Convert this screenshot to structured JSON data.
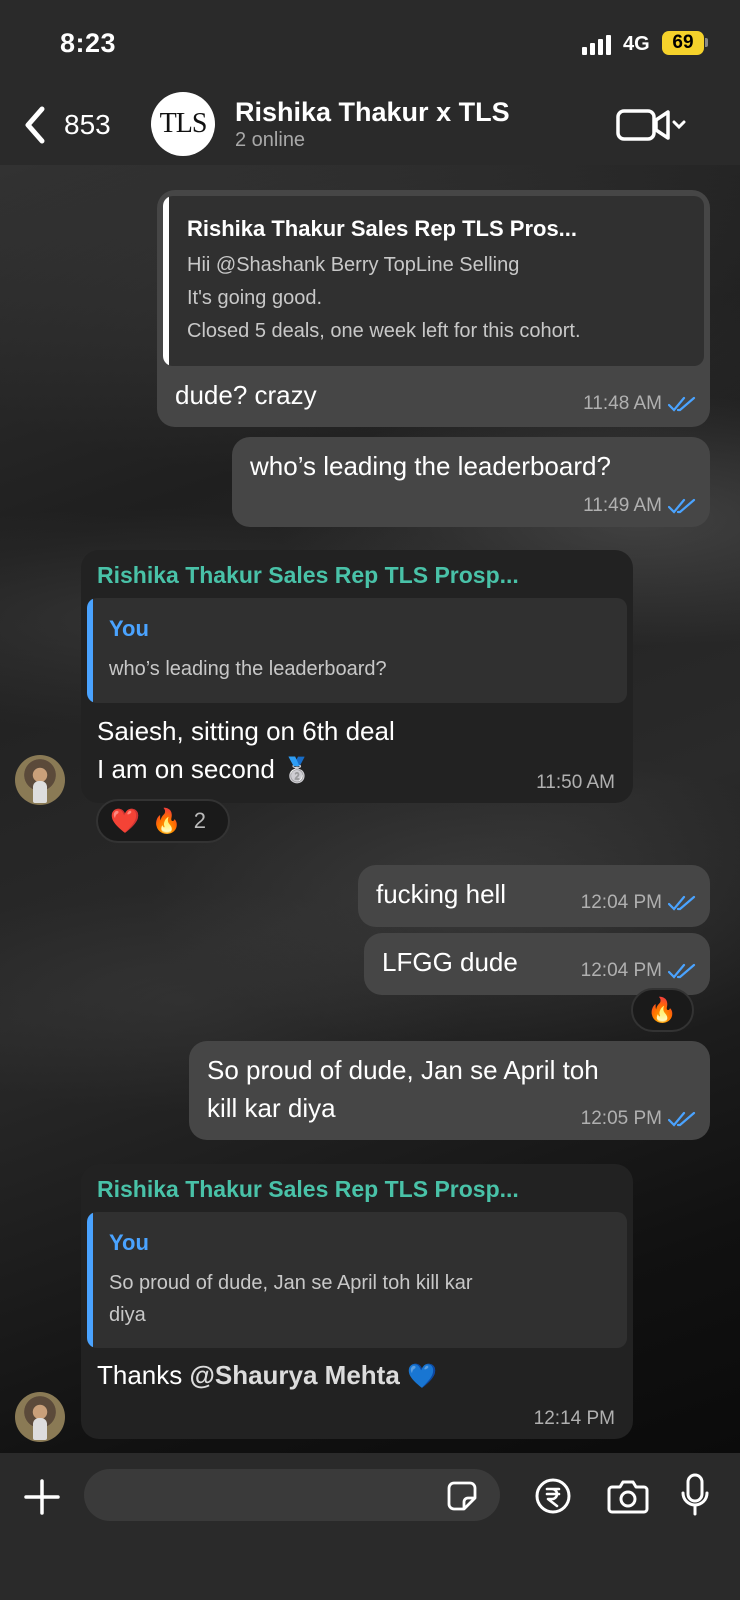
{
  "status_bar": {
    "time": "8:23",
    "network": "4G",
    "battery": "69"
  },
  "header": {
    "back_count": "853",
    "logo_text": "TLS",
    "title": "Rishika Thakur x TLS",
    "subtitle": "2 online"
  },
  "messages": [
    {
      "quote_title": "Rishika Thakur Sales Rep TLS Pros...",
      "quote_lines": [
        "Hii @Shashank Berry TopLine Selling",
        "It's going good.",
        "Closed 5 deals, one week left for this cohort."
      ],
      "text": "dude? crazy",
      "time": "11:48 AM"
    },
    {
      "text": "who’s leading the leaderboard?",
      "time": "11:49 AM"
    },
    {
      "sender": "Rishika Thakur Sales Rep TLS Prosp...",
      "quote_author": "You",
      "quote_lines": [
        "who’s leading the leaderboard?"
      ],
      "lines": [
        "Saiesh, sitting on 6th deal",
        "I am on second"
      ],
      "emoji": "🥈",
      "time": "11:50 AM",
      "reactions": {
        "e1": "❤️",
        "e2": "🔥",
        "count": "2"
      }
    },
    {
      "text": "fucking hell",
      "time": "12:04 PM"
    },
    {
      "text": "LFGG dude",
      "time": "12:04 PM",
      "reaction": "🔥"
    },
    {
      "lines": [
        "So proud of dude, Jan se April toh",
        "kill kar diya"
      ],
      "time": "12:05 PM"
    },
    {
      "sender": "Rishika Thakur Sales Rep TLS Prosp...",
      "quote_author": "You",
      "quote_lines": [
        "So proud of dude, Jan se April toh kill kar",
        "diya"
      ],
      "text_prefix": "Thanks ",
      "mention": "@Shaurya Mehta",
      "emoji": "💙",
      "time": "12:14 PM"
    }
  ],
  "colors": {
    "outgoing": "#464646",
    "incoming": "#222222",
    "sender": "#49c2a8",
    "you": "#4aa3ff",
    "ticks": "#4aa3ff",
    "battery": "#f5d22b"
  }
}
